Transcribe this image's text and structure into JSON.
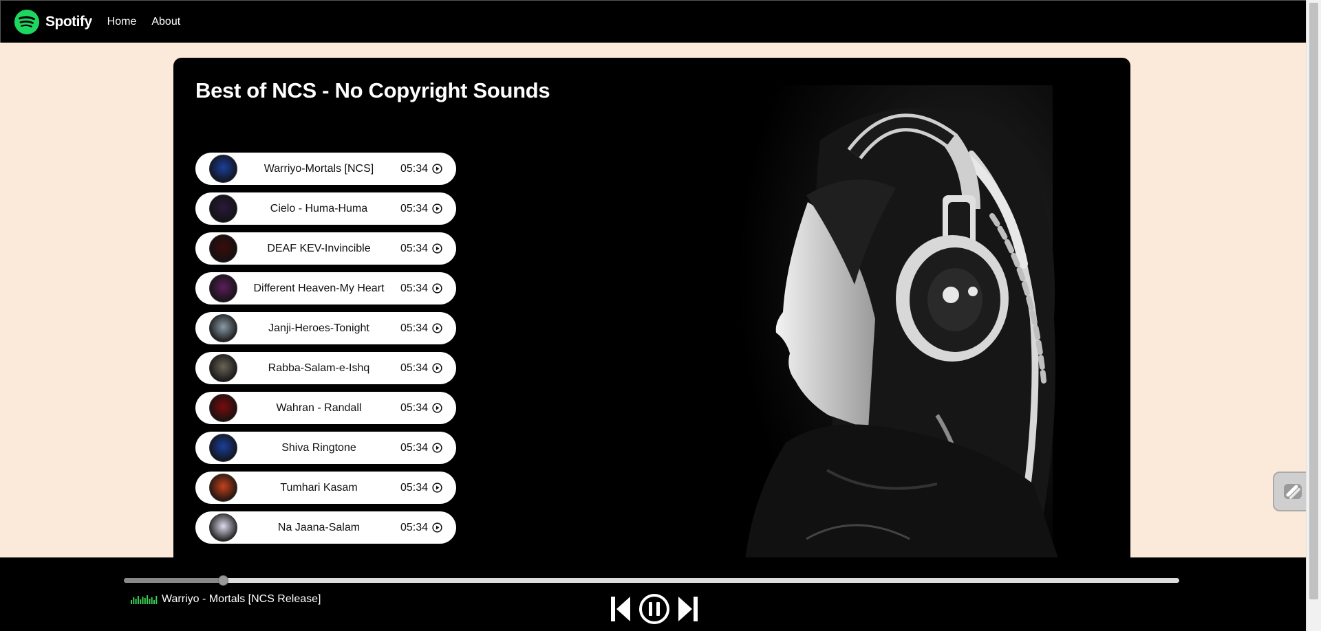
{
  "navbar": {
    "brand": "Spotify",
    "links": [
      "Home",
      "About"
    ]
  },
  "playlist": {
    "title": "Best of NCS - No Copyright Sounds",
    "songs": [
      {
        "name": "Warriyo-Mortals [NCS]",
        "duration": "05:34",
        "thumb_color": "#1b3f9b"
      },
      {
        "name": "Cielo - Huma-Huma",
        "duration": "05:34",
        "thumb_color": "#2a1a3a"
      },
      {
        "name": "DEAF KEV-Invincible",
        "duration": "05:34",
        "thumb_color": "#3a0c0c"
      },
      {
        "name": "Different Heaven-My Heart",
        "duration": "05:34",
        "thumb_color": "#5a1f5a"
      },
      {
        "name": "Janji-Heroes-Tonight",
        "duration": "05:34",
        "thumb_color": "#8a9aa6"
      },
      {
        "name": "Rabba-Salam-e-Ishq",
        "duration": "05:34",
        "thumb_color": "#6a6458"
      },
      {
        "name": "Wahran - Randall",
        "duration": "05:34",
        "thumb_color": "#7a0c0c"
      },
      {
        "name": "Shiva Ringtone",
        "duration": "05:34",
        "thumb_color": "#1b3f9b"
      },
      {
        "name": "Tumhari Kasam",
        "duration": "05:34",
        "thumb_color": "#c4421c"
      },
      {
        "name": "Na Jaana-Salam",
        "duration": "05:34",
        "thumb_color": "#dcdcec"
      }
    ]
  },
  "player": {
    "now_playing": "Warriyo - Mortals [NCS Release]",
    "progress_fraction": 0.094
  },
  "colors": {
    "brand_green": "#1ed760",
    "page_bg": "#fbeada",
    "eq_green": "#39d353"
  }
}
